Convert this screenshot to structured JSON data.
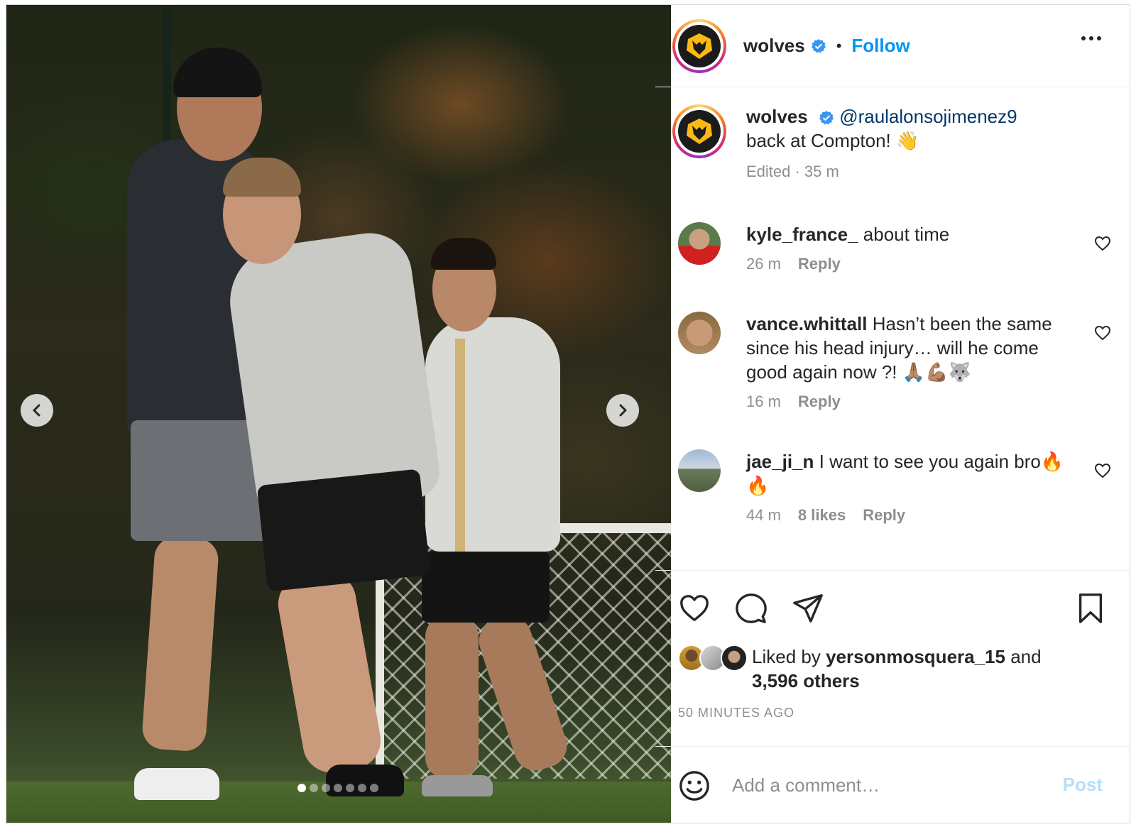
{
  "header": {
    "username": "wolves",
    "separator": "•",
    "follow_label": "Follow"
  },
  "caption": {
    "username": "wolves",
    "mention": "@raulalonsojimenez9",
    "text": "back at Compton! 👋",
    "meta": "Edited · 35 m"
  },
  "comments": [
    {
      "username": "kyle_france_",
      "text": "about time",
      "time": "26 m",
      "likes": "",
      "reply": "Reply"
    },
    {
      "username": "vance.whittall",
      "text": "Hasn’t been the same since his head injury… will he come good again now ?! 🙏🏽💪🏽🐺",
      "time": "16 m",
      "likes": "",
      "reply": "Reply"
    },
    {
      "username": "jae_ji_n",
      "text": "I want to see you again bro🔥🔥",
      "time": "44 m",
      "likes": "8 likes",
      "reply": "Reply"
    }
  ],
  "likes": {
    "prefix": "Liked by",
    "user": "yersonmosquera_15",
    "and": "and",
    "others": "3,596 others"
  },
  "posted": "50 MINUTES AGO",
  "add_comment": {
    "placeholder": "Add a comment…",
    "post_label": "Post"
  },
  "carousel": {
    "slide_count": 7,
    "active_index": 0
  },
  "colors": {
    "link": "#0095f6",
    "mention": "#00376b",
    "muted": "#8e8e8e",
    "post_disabled": "#b2dffc",
    "brand": "#fdb913"
  }
}
